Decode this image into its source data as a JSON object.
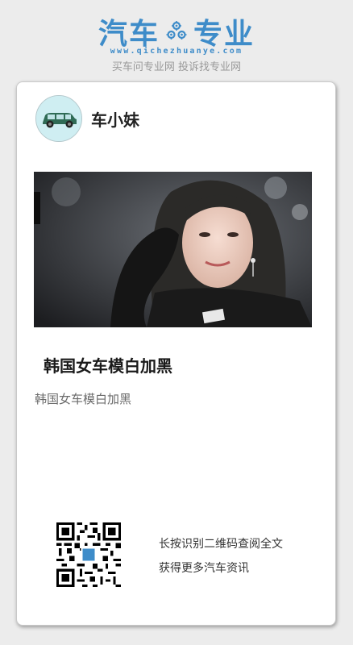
{
  "brand": {
    "left_text": "汽车",
    "right_text": "专业",
    "url": "www.qichezhuanye.com",
    "slogan": "买车问专业网 投诉找专业网",
    "accent_color": "#3e8cc9",
    "gear_icon": "gear-icon"
  },
  "card": {
    "author_name": "车小妹",
    "avatar_icon": "car-icon",
    "photo_alt": "韩国女车模白加黑",
    "title": "韩国女车模白加黑",
    "description": "韩国女车模白加黑",
    "qr_icon": "qr-code-icon",
    "qr_caption_line1": "长按识别二维码查阅全文",
    "qr_caption_line2": "获得更多汽车资讯"
  }
}
